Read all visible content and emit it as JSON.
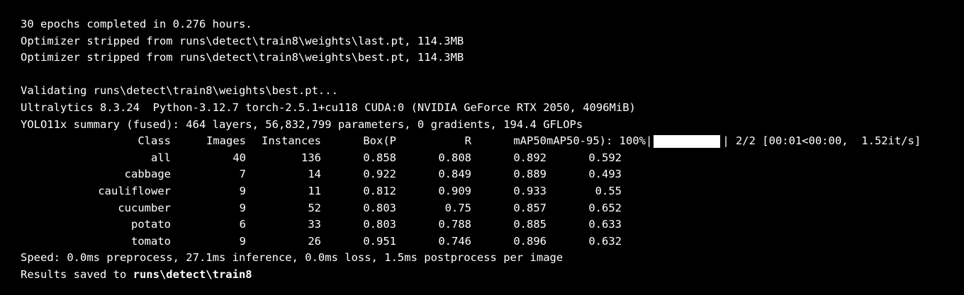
{
  "lines_top": [
    "30 epochs completed in 0.276 hours.",
    "Optimizer stripped from runs\\detect\\train8\\weights\\last.pt, 114.3MB",
    "Optimizer stripped from runs\\detect\\train8\\weights\\best.pt, 114.3MB"
  ],
  "validating": "Validating runs\\detect\\train8\\weights\\best.pt...",
  "env": "Ultralytics 8.3.24  Python-3.12.7 torch-2.5.1+cu118 CUDA:0 (NVIDIA GeForce RTX 2050, 4096MiB)",
  "summary": "YOLO11x summary (fused): 464 layers, 56,832,799 parameters, 0 gradients, 194.4 GFLOPs",
  "table": {
    "headers": {
      "class": "Class",
      "images": "Images",
      "instances": "Instances",
      "p": "Box(P",
      "r": "R",
      "map50": "mAP50",
      "map50_95_prefix": "mAP50-95): 100%|",
      "progress_suffix": "| 2/2 [00:01<00:00,  1.52it/s]"
    },
    "progress": 1.0,
    "rows": [
      {
        "class": "all",
        "images": "40",
        "instances": "136",
        "p": "0.858",
        "r": "0.808",
        "map50": "0.892",
        "map50_95": "0.592"
      },
      {
        "class": "cabbage",
        "images": "7",
        "instances": "14",
        "p": "0.922",
        "r": "0.849",
        "map50": "0.889",
        "map50_95": "0.493"
      },
      {
        "class": "cauliflower",
        "images": "9",
        "instances": "11",
        "p": "0.812",
        "r": "0.909",
        "map50": "0.933",
        "map50_95": "0.55"
      },
      {
        "class": "cucumber",
        "images": "9",
        "instances": "52",
        "p": "0.803",
        "r": "0.75",
        "map50": "0.857",
        "map50_95": "0.652"
      },
      {
        "class": "potato",
        "images": "6",
        "instances": "33",
        "p": "0.803",
        "r": "0.788",
        "map50": "0.885",
        "map50_95": "0.633"
      },
      {
        "class": "tomato",
        "images": "9",
        "instances": "26",
        "p": "0.951",
        "r": "0.746",
        "map50": "0.896",
        "map50_95": "0.632"
      }
    ]
  },
  "speed": "Speed: 0.0ms preprocess, 27.1ms inference, 0.0ms loss, 1.5ms postprocess per image",
  "results_prefix": "Results saved to ",
  "results_path": "runs\\detect\\train8",
  "colors": {
    "background": "#000000",
    "text": "#ffffff"
  }
}
